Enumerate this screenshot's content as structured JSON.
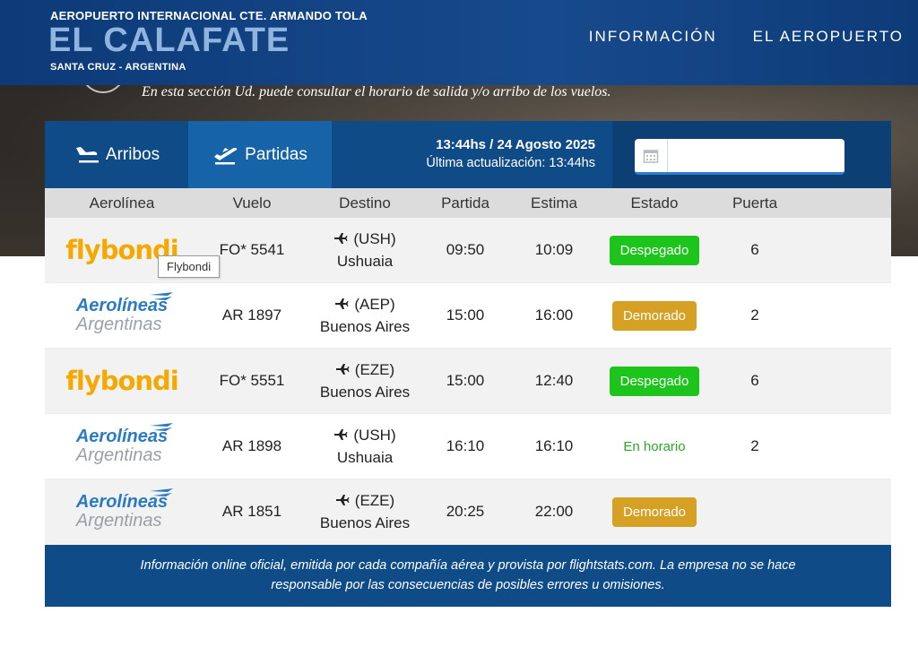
{
  "header": {
    "brand_top": "AEROPUERTO INTERNACIONAL CTE. ARMANDO TOLA",
    "brand_main": "EL CALAFATE",
    "brand_sub": "SANTA CRUZ - ARGENTINA",
    "nav": [
      "INFORMACIÓN",
      "EL AEROPUERTO"
    ]
  },
  "intro": "En esta sección Ud. puede consultar el horario de salida y/o arribo de los vuelos.",
  "tabs": {
    "arrivals": "Arribos",
    "departures": "Partidas",
    "active": "departures"
  },
  "timeinfo": {
    "line1": "13:44hs / 24 Agosto 2025",
    "line2": "Última actualización: 13:44hs"
  },
  "date_input": {
    "value": "",
    "placeholder": ""
  },
  "table": {
    "headers": [
      "Aerolínea",
      "Vuelo",
      "Destino",
      "Partida",
      "Estima",
      "Estado",
      "Puerta"
    ],
    "rows": [
      {
        "airline": "flybondi",
        "flight": "FO* 5541",
        "dest_code": "(USH)",
        "dest_city": "Ushuaia",
        "departure": "09:50",
        "estimate": "10:09",
        "status": "Despegado",
        "status_type": "green",
        "gate": "6"
      },
      {
        "airline": "aerolineas",
        "flight": "AR 1897",
        "dest_code": "(AEP)",
        "dest_city": "Buenos Aires",
        "departure": "15:00",
        "estimate": "16:00",
        "status": "Demorado",
        "status_type": "orange",
        "gate": "2"
      },
      {
        "airline": "flybondi",
        "flight": "FO* 5551",
        "dest_code": "(EZE)",
        "dest_city": "Buenos Aires",
        "departure": "15:00",
        "estimate": "12:40",
        "status": "Despegado",
        "status_type": "green",
        "gate": "6"
      },
      {
        "airline": "aerolineas",
        "flight": "AR 1898",
        "dest_code": "(USH)",
        "dest_city": "Ushuaia",
        "departure": "16:10",
        "estimate": "16:10",
        "status": "En horario",
        "status_type": "text",
        "gate": "2"
      },
      {
        "airline": "aerolineas",
        "flight": "AR 1851",
        "dest_code": "(EZE)",
        "dest_city": "Buenos Aires",
        "departure": "20:25",
        "estimate": "22:00",
        "status": "Demorado",
        "status_type": "orange",
        "gate": ""
      }
    ]
  },
  "logos": {
    "flybondi": "flybondi",
    "aerolineas_l1": "Aerolíneas",
    "aerolineas_l2": "Argentinas"
  },
  "tooltip": "Flybondi",
  "footer": {
    "line1": "Información online oficial, emitida por cada compañía aérea y provista por flightstats.com. La empresa no se hace",
    "line2": "responsable por las consecuencias de posibles errores u omisiones."
  },
  "colors": {
    "header_bg": "#0f3f7d",
    "panel_bg": "#0f4b87",
    "tab_active": "#1663a8",
    "status_green": "#1cc41c",
    "status_orange": "#d6a024",
    "flybondi": "#f5a800",
    "aerolineas_blue": "#2b7bc2"
  }
}
